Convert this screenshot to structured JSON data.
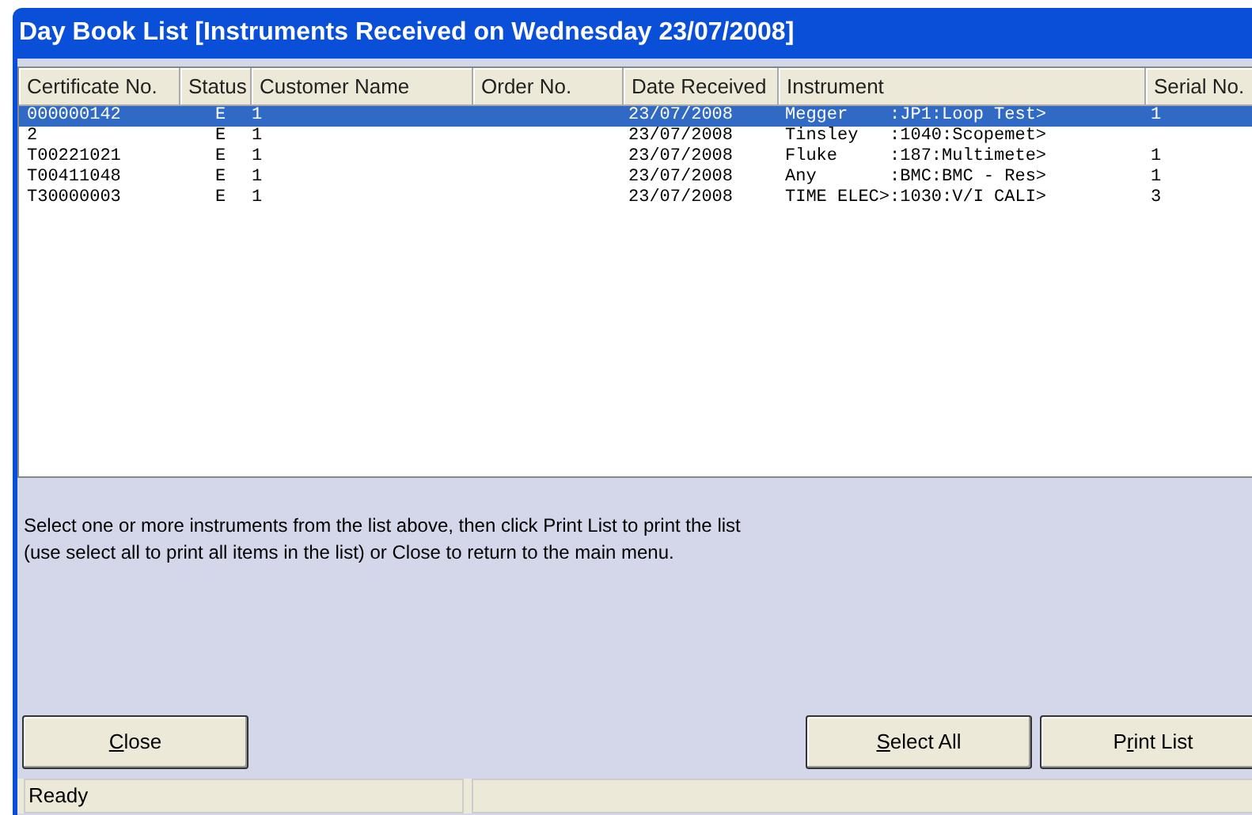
{
  "window": {
    "title": "Day Book List [Instruments Received on Wednesday 23/07/2008]"
  },
  "table": {
    "columns": [
      "Certificate No.",
      "Status",
      "Customer Name",
      "Order No.",
      "Date Received",
      "Instrument",
      "Serial No."
    ],
    "rows": [
      {
        "selected": true,
        "cells": [
          "000000142",
          "E",
          "1",
          "",
          "23/07/2008",
          "Megger    :JP1:Loop Test>",
          "1"
        ]
      },
      {
        "selected": false,
        "cells": [
          "2",
          "E",
          "1",
          "",
          "23/07/2008",
          "Tinsley   :1040:Scopemet>",
          ""
        ]
      },
      {
        "selected": false,
        "cells": [
          "T00221021",
          "E",
          "1",
          "",
          "23/07/2008",
          "Fluke     :187:Multimete>",
          "1"
        ]
      },
      {
        "selected": false,
        "cells": [
          "T00411048",
          "E",
          "1",
          "",
          "23/07/2008",
          "Any       :BMC:BMC - Res>",
          "1"
        ]
      },
      {
        "selected": false,
        "cells": [
          "T30000003",
          "E",
          "1",
          "",
          "23/07/2008",
          "TIME ELEC>:1030:V/I CALI>",
          "3"
        ]
      }
    ]
  },
  "instructions": [
    "Select one or more instruments from the list above, then click Print List to print the list",
    "(use select all to print all items in the list) or Close to return to the main menu."
  ],
  "buttons": [
    {
      "access_key": "C",
      "label_after": "lose"
    },
    {
      "access_key": "S",
      "label_after": "elect All"
    },
    {
      "label_before": "P",
      "access_key": "r",
      "label_after": "int List"
    }
  ],
  "status_bar": {
    "text": "Ready"
  }
}
